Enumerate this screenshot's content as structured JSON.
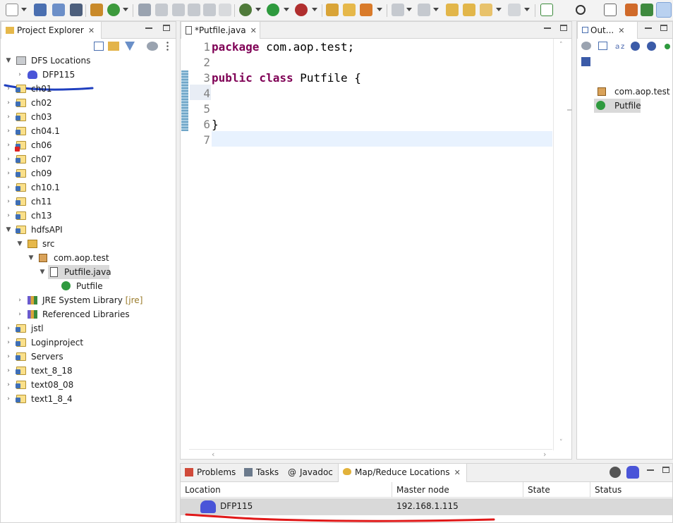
{
  "project_explorer": {
    "title": "Project Explorer",
    "tree": [
      {
        "label": "DFS Locations"
      },
      {
        "label": "DFP115"
      },
      {
        "label": "ch01"
      },
      {
        "label": "ch02"
      },
      {
        "label": "ch03"
      },
      {
        "label": "ch04.1"
      },
      {
        "label": "ch06"
      },
      {
        "label": "ch07"
      },
      {
        "label": "ch09"
      },
      {
        "label": "ch10.1"
      },
      {
        "label": "ch11"
      },
      {
        "label": "ch13"
      },
      {
        "label": "hdfsAPI"
      },
      {
        "label": "src"
      },
      {
        "label": "com.aop.test"
      },
      {
        "label": "Putfile.java"
      },
      {
        "label": "Putfile"
      },
      {
        "label": "JRE System Library",
        "suffix": "[jre]"
      },
      {
        "label": "Referenced Libraries"
      },
      {
        "label": "jstl"
      },
      {
        "label": "Loginproject"
      },
      {
        "label": "Servers"
      },
      {
        "label": "text_8_18"
      },
      {
        "label": "text08_08"
      },
      {
        "label": "text1_8_4"
      }
    ]
  },
  "editor": {
    "tab_title": "*Putfile.java",
    "lines": [
      {
        "num": "1",
        "kw": "package",
        "rest": " com.aop.test;"
      },
      {
        "num": "2",
        "kw": "",
        "rest": ""
      },
      {
        "num": "3",
        "kw": "public class",
        "rest": " Putfile {"
      },
      {
        "num": "4",
        "kw": "",
        "rest": ""
      },
      {
        "num": "5",
        "kw": "",
        "rest": ""
      },
      {
        "num": "6",
        "kw": "",
        "rest": "}"
      },
      {
        "num": "7",
        "kw": "",
        "rest": ""
      }
    ]
  },
  "outline": {
    "title": "Out...",
    "items": [
      {
        "label": "com.aop.test"
      },
      {
        "label": "Putfile"
      }
    ]
  },
  "bottom_panel": {
    "tabs": [
      {
        "label": "Problems"
      },
      {
        "label": "Tasks"
      },
      {
        "label": "Javadoc"
      },
      {
        "label": "Map/Reduce Locations"
      }
    ],
    "columns": [
      "Location",
      "Master node",
      "State",
      "Status"
    ],
    "rows": [
      {
        "location": "DFP115",
        "master_node": "192.168.1.115",
        "state": "",
        "status": ""
      }
    ]
  },
  "colors": {
    "annotation_blue": "#1f3fbf",
    "annotation_red": "#e01818",
    "keyword": "#7f0055",
    "selection": "#d9d9d9"
  }
}
